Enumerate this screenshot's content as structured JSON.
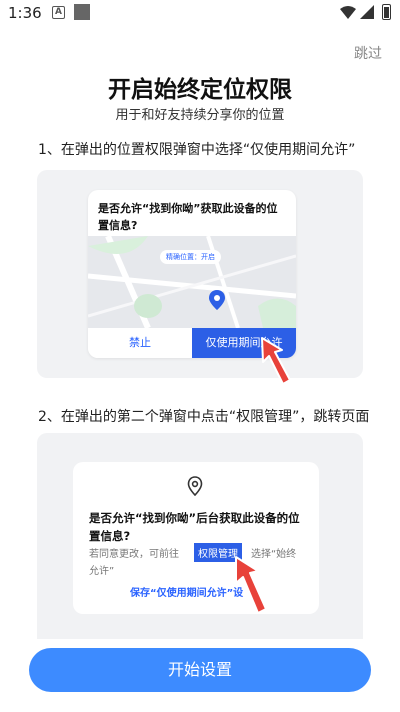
{
  "status": {
    "time": "1:36",
    "notif_letter": "A"
  },
  "header": {
    "skip_label": "跳过"
  },
  "hero": {
    "title": "开启始终定位权限",
    "subtitle": "用于和好友持续分享你的位置"
  },
  "step1": {
    "text": "1、在弹出的位置权限弹窗中选择“仅使用期间允许”",
    "dialog": {
      "question": "是否允许“找到你呦”获取此设备的位置信息?",
      "precise_label": "精确位置：开启",
      "deny_label": "禁止",
      "allow_label": "仅使用期间允许"
    }
  },
  "step2": {
    "text": "2、在弹出的第二个弹窗中点击“权限管理”，跳转页面",
    "dialog": {
      "question": "是否允许“找到你呦”后台获取此设备的位置信息?",
      "hint_before": "若同意更改，可前往",
      "permission_button": "权限管理",
      "hint_after": "选择“始终",
      "hint_line2": "允许”",
      "save_link": "保存“仅使用期间允许”设"
    }
  },
  "footer": {
    "start_button": "开始设置"
  },
  "colors": {
    "accent": "#3d8bff",
    "dialog_blue": "#2c5fe6",
    "arrow_red": "#e8423a"
  }
}
